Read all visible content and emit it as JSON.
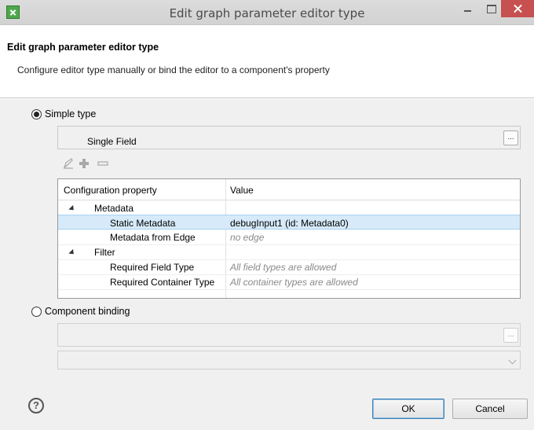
{
  "window": {
    "title": "Edit graph parameter editor type"
  },
  "header": {
    "title": "Edit graph parameter editor type",
    "description": "Configure editor type manually or bind the editor to a component's property"
  },
  "simple_type": {
    "label": "Simple type",
    "selected": true,
    "field_value": "Single Field",
    "dots_label": "..."
  },
  "toolbar": {
    "icons": [
      "edit-icon",
      "add-icon",
      "remove-icon"
    ]
  },
  "table": {
    "columns": [
      "Configuration property",
      "Value"
    ],
    "rows": [
      {
        "name": "Metadata",
        "value": "",
        "group": true
      },
      {
        "name": "Static Metadata",
        "value": "debugInput1 (id: Metadata0)",
        "group": false,
        "selected": true
      },
      {
        "name": "Metadata from Edge",
        "value": "no edge",
        "group": false,
        "placeholder": true
      },
      {
        "name": "Filter",
        "value": "",
        "group": true
      },
      {
        "name": "Required Field Type",
        "value": "All field types are allowed",
        "group": false,
        "placeholder": true
      },
      {
        "name": "Required Container Type",
        "value": "All container types are allowed",
        "group": false,
        "placeholder": true
      }
    ]
  },
  "component_binding": {
    "label": "Component binding",
    "selected": false,
    "field_value": "",
    "dots_label": "...",
    "combo_value": ""
  },
  "footer": {
    "help_symbol": "?",
    "ok_label": "OK",
    "cancel_label": "Cancel"
  },
  "colors": {
    "close_button": "#c75050",
    "selected_row": "#d6eaf9",
    "dialog_bg": "#f0f0f0"
  }
}
